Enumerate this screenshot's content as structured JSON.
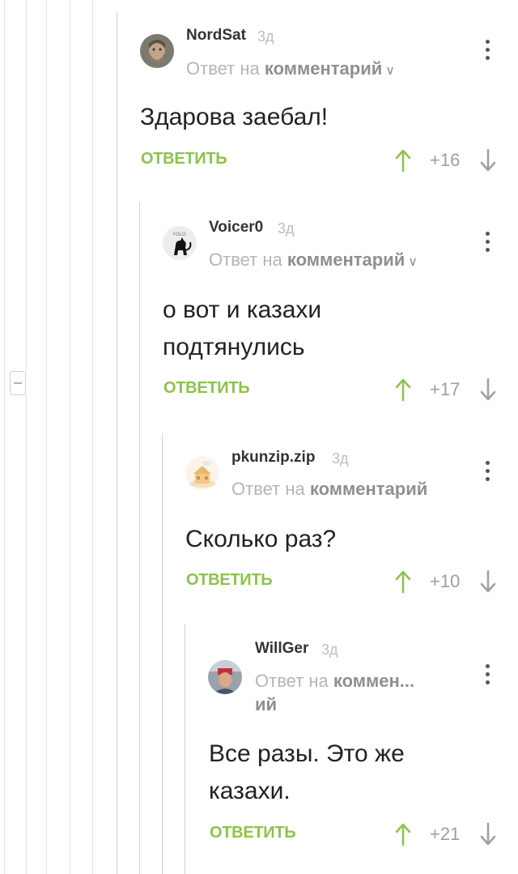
{
  "colors": {
    "accent_green": "#8bc34a",
    "muted": "#b5b5b5",
    "line": "#e6e6e6"
  },
  "comments": [
    {
      "author": "NordSat",
      "age": "3д",
      "reply_prefix": "Ответ на",
      "reply_link": "комментарий",
      "text_lines": [
        "Здарова заебал!"
      ],
      "reply_btn": "ОТВЕТИТЬ",
      "score": "+16",
      "avatar_icon": "bearded-man-photo"
    },
    {
      "author": "Voicer0",
      "age": "3д",
      "reply_prefix": "Ответ на",
      "reply_link": "комментарий",
      "text_lines": [
        "о вот и казахи",
        "подтянулись"
      ],
      "reply_btn": "ОТВЕТИТЬ",
      "score": "+17",
      "avatar_icon": "black-cat-sticker"
    },
    {
      "author": "pkunzip.zip",
      "age": "3д",
      "reply_prefix": "Ответ на",
      "reply_link": "комментарий",
      "text_lines": [
        "Сколько раз?"
      ],
      "reply_btn": "ОТВЕТИТЬ",
      "score": "+10",
      "avatar_icon": "cartoon-house"
    },
    {
      "author": "WillGer",
      "age": "3д",
      "reply_prefix": "Ответ на",
      "reply_link": "коммен...",
      "reply_link_wrap": "ий",
      "text_lines": [
        "Все разы. Это же",
        "казахи."
      ],
      "reply_btn": "ОТВЕТИТЬ",
      "score": "+21",
      "avatar_icon": "person-photo"
    }
  ]
}
